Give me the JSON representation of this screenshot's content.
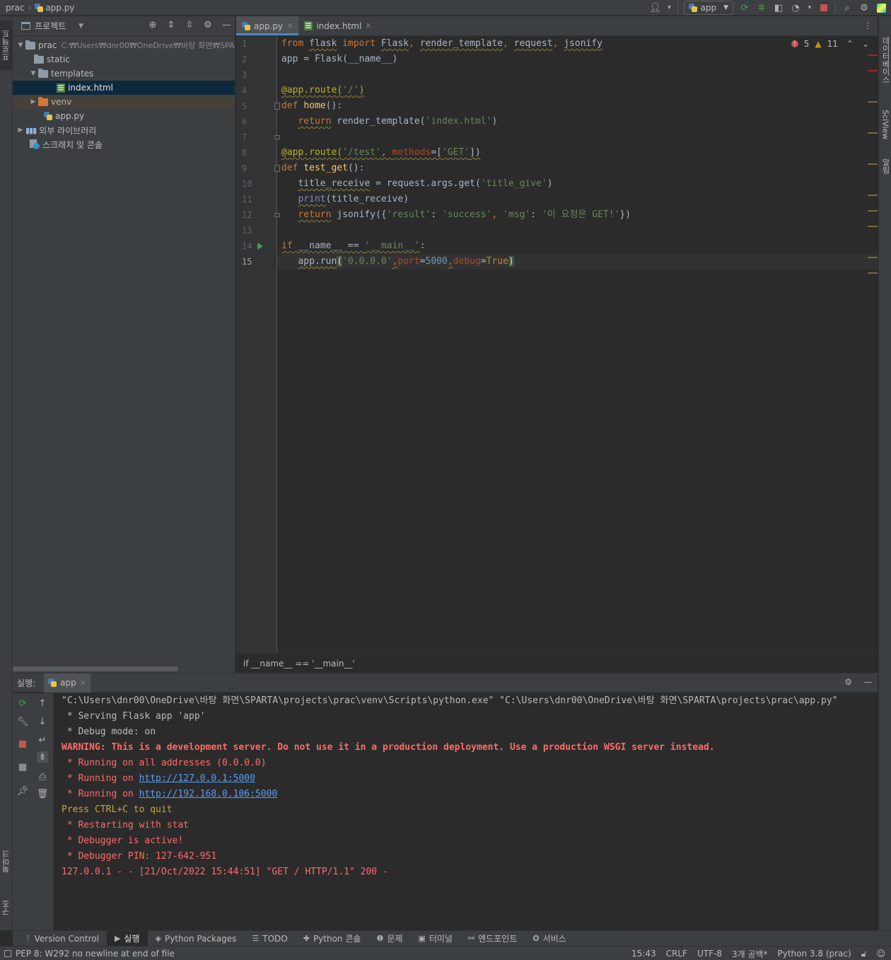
{
  "breadcrumb": {
    "project": "prac",
    "file": "app.py"
  },
  "run_config": {
    "name": "app"
  },
  "colors": {
    "accent": "#4a88c7",
    "error": "#ff6b68",
    "run_green": "#499c54",
    "link": "#589df6"
  },
  "left_stripe": {
    "project_tab": "프로젝트",
    "bookmarks_tab": "북마크",
    "structure_tab": "구조"
  },
  "right_stripe": {
    "database_tab": "데이터베이스",
    "sciview_tab": "SciView",
    "notifications_tab": "알림"
  },
  "project_panel": {
    "title": "프로젝트",
    "tree": [
      {
        "label": "prac",
        "path": "C:₩Users₩dnr00₩OneDrive₩바탕 화면₩SPA"
      },
      {
        "label": "static"
      },
      {
        "label": "templates"
      },
      {
        "label": "index.html"
      },
      {
        "label": "venv"
      },
      {
        "label": "app.py"
      },
      {
        "label": "외부 라이브러리"
      },
      {
        "label": "스크래치 및 콘솔"
      }
    ]
  },
  "editor": {
    "tabs": [
      {
        "label": "app.py"
      },
      {
        "label": "index.html"
      }
    ],
    "line_numbers": [
      "1",
      "2",
      "3",
      "4",
      "5",
      "6",
      "7",
      "8",
      "9",
      "10",
      "11",
      "12",
      "13",
      "14",
      "15"
    ],
    "code": {
      "l1_from": "from",
      "l1_flask": "flask",
      "l1_import": "import",
      "l1_rest1": "Flask",
      "l1_sep1": ", ",
      "l1_rest2": "render_template",
      "l1_sep2": ", ",
      "l1_rest3": "request",
      "l1_sep3": ", ",
      "l1_rest4": "jsonify",
      "l2": "app = Flask(__name__)",
      "l4_deco": "@app.route(",
      "l4_str": "'/'",
      "l4_end": ")",
      "l5_def": "def",
      "l5_fn": "home",
      "l5_end": "():",
      "l6_ret": "return",
      "l6_mid": " render_template(",
      "l6_str": "'index.html'",
      "l6_end": ")",
      "l8_deco": "@app.route(",
      "l8_str": "'/test'",
      "l8_sep": ", ",
      "l8_param": "methods",
      "l8_eq": "=[",
      "l8_str2": "'GET'",
      "l8_end": "])",
      "l9_def": "def",
      "l9_fn": "test_get",
      "l9_end": "():",
      "l10_var": "title_receive",
      "l10_mid": " = request.args.get(",
      "l10_str": "'title_give'",
      "l10_end": ")",
      "l11_fn": "print",
      "l11_end": "(title_receive)",
      "l12_ret": "return",
      "l12_mid": " jsonify({",
      "l12_s1": "'result'",
      "l12_c1": ": ",
      "l12_s2": "'success'",
      "l12_c2": ", ",
      "l12_s3": "'msg'",
      "l12_c3": ": ",
      "l12_s4": "'이 요청은 GET!'",
      "l12_end": "})",
      "l14_if": "if",
      "l14_name": " __name__",
      "l14_eq": " == ",
      "l14_str": "'__main__'",
      "l14_end": ":",
      "l15_a": "app.run",
      "l15_open": "(",
      "l15_str": "'0.0.0.0'",
      "l15_c1": ",",
      "l15_p1": "port",
      "l15_eq1": "=",
      "l15_num": "5000",
      "l15_c2": ",",
      "l15_p2": "debug",
      "l15_eq2": "=",
      "l15_true": "True",
      "l15_close": ")"
    },
    "inspections": {
      "errors": "5",
      "warnings": "11"
    },
    "status_breadcrumb": "if __name__ == '__main__'"
  },
  "run_panel": {
    "label": "실행:",
    "tab": "app",
    "output": [
      "\"C:\\Users\\dnr00\\OneDrive\\바탕 화면\\SPARTA\\projects\\prac\\venv\\Scripts\\python.exe\" \"C:\\Users\\dnr00\\OneDrive\\바탕 화면\\SPARTA\\projects\\prac\\app.py\"",
      " * Serving Flask app 'app'",
      " * Debug mode: on",
      "WARNING: This is a development server. Do not use it in a production deployment. Use a production WSGI server instead.",
      " * Running on all addresses (0.0.0.0)",
      " * Running on ",
      "http://127.0.0.1:5000",
      " * Running on ",
      "http://192.168.0.106:5000",
      "Press CTRL+C to quit",
      " * Restarting with stat",
      " * Debugger is active!",
      " * Debugger PIN: 127-642-951",
      "127.0.0.1 - - [21/Oct/2022 15:44:51] \"GET / HTTP/1.1\" 200 -"
    ]
  },
  "tool_windows": [
    {
      "label": "Version Control"
    },
    {
      "label": "실행"
    },
    {
      "label": "Python Packages"
    },
    {
      "label": "TODO"
    },
    {
      "label": "Python 콘솔"
    },
    {
      "label": "문제"
    },
    {
      "label": "터미널"
    },
    {
      "label": "엔드포인트"
    },
    {
      "label": "서비스"
    }
  ],
  "status_bar": {
    "message": "PEP 8: W292 no newline at end of file",
    "position": "15:43",
    "line_sep": "CRLF",
    "encoding": "UTF-8",
    "indent": "3개 공백*",
    "interpreter": "Python 3.8 (prac)"
  }
}
